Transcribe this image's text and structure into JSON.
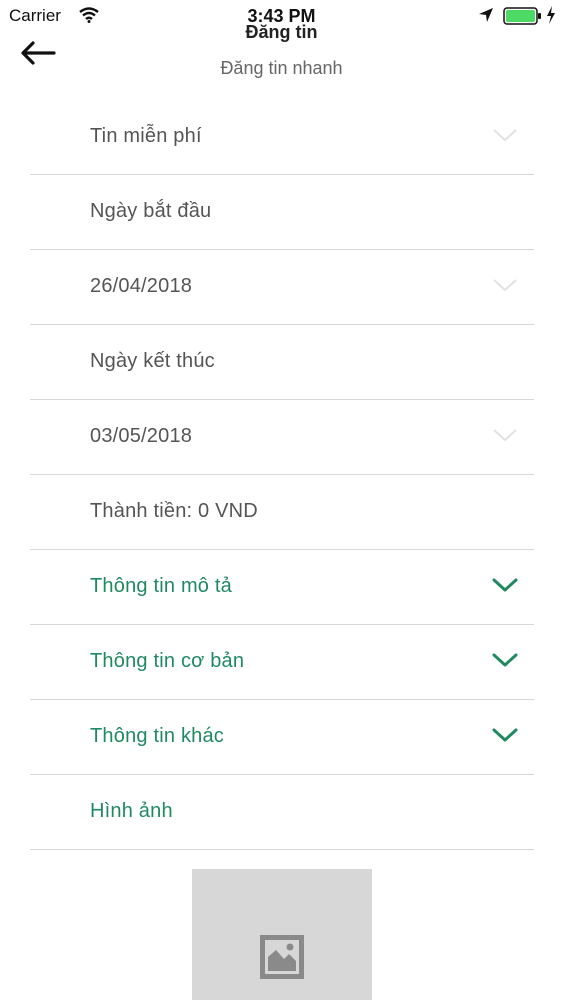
{
  "status_bar": {
    "carrier": "Carrier",
    "time": "3:43 PM",
    "battery_color": "#4cd964"
  },
  "nav": {
    "title": "Đăng tin",
    "subtitle": "Đăng tin nhanh",
    "back_icon": "arrow-left-icon"
  },
  "form": {
    "rows": [
      {
        "label": "Tin miễn phí",
        "chevron": "light"
      },
      {
        "label": "Ngày bắt đầu"
      },
      {
        "label": "26/04/2018",
        "chevron": "light"
      },
      {
        "label": "Ngày kết thúc"
      },
      {
        "label": "03/05/2018",
        "chevron": "light"
      },
      {
        "label": "Thành tiền: 0 VND"
      },
      {
        "label": "Thông tin mô tả",
        "chevron": "green"
      },
      {
        "label": "Thông tin cơ bản",
        "chevron": "green"
      },
      {
        "label": "Thông tin khác",
        "chevron": "green"
      },
      {
        "label": "Hình ảnh"
      }
    ]
  },
  "colors": {
    "accent_green": "#1f8a62",
    "divider": "#d8d8d8",
    "photo_placeholder": "#d7d7d7"
  },
  "photo": {
    "icon": "image-placeholder-icon"
  }
}
